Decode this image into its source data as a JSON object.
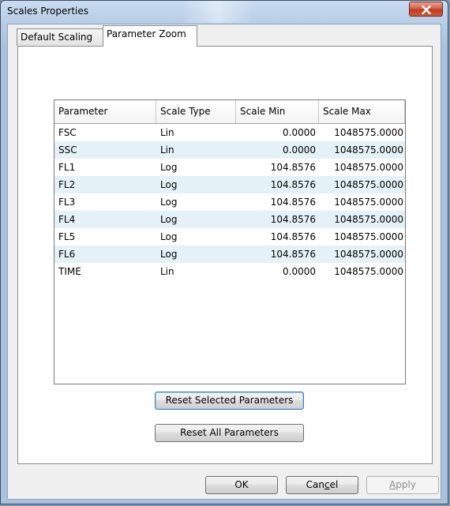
{
  "window": {
    "title": "Scales Properties"
  },
  "tabs": [
    {
      "label": "Default Scaling",
      "selected": false
    },
    {
      "label": "Parameter Zoom",
      "selected": true
    }
  ],
  "grid": {
    "columns": [
      "Parameter",
      "Scale Type",
      "Scale Min",
      "Scale Max"
    ],
    "rows": [
      {
        "parameter": "FSC",
        "scale_type": "Lin",
        "scale_min": "0.0000",
        "scale_max": "1048575.0000"
      },
      {
        "parameter": "SSC",
        "scale_type": "Lin",
        "scale_min": "0.0000",
        "scale_max": "1048575.0000"
      },
      {
        "parameter": "FL1",
        "scale_type": "Log",
        "scale_min": "104.8576",
        "scale_max": "1048575.0000"
      },
      {
        "parameter": "FL2",
        "scale_type": "Log",
        "scale_min": "104.8576",
        "scale_max": "1048575.0000"
      },
      {
        "parameter": "FL3",
        "scale_type": "Log",
        "scale_min": "104.8576",
        "scale_max": "1048575.0000"
      },
      {
        "parameter": "FL4",
        "scale_type": "Log",
        "scale_min": "104.8576",
        "scale_max": "1048575.0000"
      },
      {
        "parameter": "FL5",
        "scale_type": "Log",
        "scale_min": "104.8576",
        "scale_max": "1048575.0000"
      },
      {
        "parameter": "FL6",
        "scale_type": "Log",
        "scale_min": "104.8576",
        "scale_max": "1048575.0000"
      },
      {
        "parameter": "TIME",
        "scale_type": "Lin",
        "scale_min": "0.0000",
        "scale_max": "1048575.0000"
      }
    ]
  },
  "buttons": {
    "reset_selected": "Reset Selected Parameters",
    "reset_all": "Reset All Parameters",
    "ok": "OK",
    "cancel_prefix": "Can",
    "cancel_mnemonic": "c",
    "cancel_suffix": "el",
    "apply_mnemonic": "A",
    "apply_suffix": "pply"
  },
  "icons": {
    "close": "close-icon"
  },
  "colors": {
    "alt_row": "#e4f1f6",
    "close_button": "#c0391f"
  }
}
